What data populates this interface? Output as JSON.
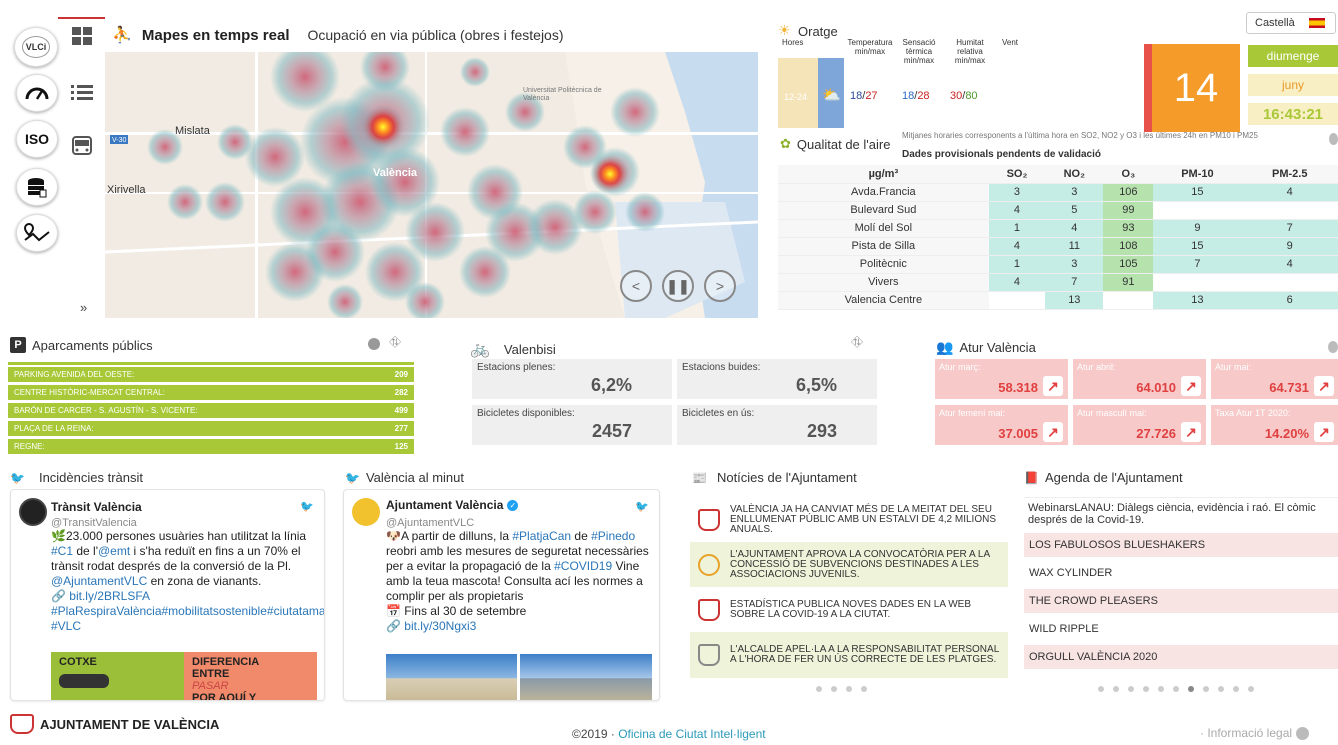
{
  "sidebar": {
    "logo": "VLCi",
    "iso_label": "ISO",
    "expand_label": "»"
  },
  "map": {
    "title": "Mapes en temps real",
    "subtitle": "Ocupació en via pública (obres i festejos)",
    "labels": {
      "mislata": "Mislata",
      "xirivella": "Xirivella",
      "valencia": "València",
      "university": "Universitat Politècnica de València",
      "road": "V-30"
    }
  },
  "weather": {
    "title": "Oratge",
    "col_hours": "Hores",
    "col_temp": "Temperatura min/max",
    "col_feel": "Sensació tèrmica min/max",
    "col_humidity": "Humitat relativa min/max",
    "col_wind": "Vent",
    "hours": "12-24",
    "temp_min": "18",
    "temp_max": "27",
    "feel_min": "18",
    "feel_max": "28",
    "hum_min": "30",
    "hum_max": "80",
    "sep": "/",
    "big_number": "14",
    "language": "Castellà",
    "day": "diumenge",
    "month": "juny",
    "time": "16:43:21"
  },
  "air": {
    "title": "Qualitat de l'aire",
    "note": "Mitjanes horaries corresponents a l'última hora en SO2, NO2 y O3 i les últimes 24h en PM10 i PM25",
    "warning": "Dades provisionals pendents de validació",
    "headers": [
      "µg/m³",
      "SO₂",
      "NO₂",
      "O₃",
      "PM-10",
      "PM-2.5"
    ],
    "rows": [
      [
        "Avda.Francia",
        "3",
        "3",
        "106",
        "15",
        "4"
      ],
      [
        "Bulevard Sud",
        "4",
        "5",
        "99",
        "",
        ""
      ],
      [
        "Molí del Sol",
        "1",
        "4",
        "93",
        "9",
        "7"
      ],
      [
        "Pista de Silla",
        "4",
        "11",
        "108",
        "15",
        "9"
      ],
      [
        "Politècnic",
        "1",
        "3",
        "105",
        "7",
        "4"
      ],
      [
        "Vivers",
        "4",
        "7",
        "91",
        "",
        ""
      ],
      [
        "Valencia Centre",
        "",
        "13",
        "",
        "13",
        "6"
      ]
    ]
  },
  "parking": {
    "title": "Aparcaments públics",
    "rows": [
      {
        "name": "PARKING AVENIDA DEL OESTE:",
        "value": "209"
      },
      {
        "name": "CENTRE HISTÒRIC-MERCAT CENTRAL:",
        "value": "282"
      },
      {
        "name": "BARÓN DE CARCER - S. AGUSTÍN - S. VICENTE:",
        "value": "499"
      },
      {
        "name": "PLAÇA DE LA REINA:",
        "value": "277"
      },
      {
        "name": "REGNE:",
        "value": "125"
      }
    ]
  },
  "valenbisi": {
    "title": "Valenbisi",
    "full_label": "Estacions plenes:",
    "full_value": "6,2%",
    "empty_label": "Estacions buides:",
    "empty_value": "6,5%",
    "avail_label": "Bicicletes disponibles:",
    "avail_value": "2457",
    "use_label": "Bicicletes en ús:",
    "use_value": "293"
  },
  "atur": {
    "title": "Atur València",
    "boxes": [
      {
        "label": "Atur març:",
        "value": "58.318"
      },
      {
        "label": "Atur abril:",
        "value": "64.010"
      },
      {
        "label": "Atur mai:",
        "value": "64.731"
      },
      {
        "label": "Atur femení mai:",
        "value": "37.005"
      },
      {
        "label": "Atur masculí mai:",
        "value": "27.726"
      },
      {
        "label": "Taxa Atur 1T 2020:",
        "value": "14.20%"
      }
    ]
  },
  "traffic": {
    "title": "Incidències trànsit",
    "name": "Trànsit València",
    "handle": "@TransitValencia",
    "text1": "23.000 persones usuàries han utilitzat la línia ",
    "tag1": "#C1",
    "text2": " de l'",
    "mention1": "@emt",
    "text3": " i s'ha reduït en fins a un 70% el trànsit rodat després de la conversió de la Pl. ",
    "mention2": "@AjuntamentVLC",
    "text4": " en zona de vianants.",
    "link": "bit.ly/2BRLSFA",
    "tags": "#PlaRespiraValència#mobilitatsostenible#ciutatamable#València #VLC",
    "img_text1": "COTXE",
    "img_text2": "DIFERENCIA ENTRE",
    "img_text3": "PASAR",
    "img_text4": "POR AQUÍ Y"
  },
  "minute": {
    "title": "València al minut",
    "name": "Ajuntament València",
    "handle": "@AjuntamentVLC",
    "text1": "A partir de dilluns, la ",
    "tag1": "#PlatjaCan",
    "text2": " de ",
    "tag2": "#Pinedo",
    "text3": " reobri amb les mesures de seguretat necessàries per a evitar la propagació de la ",
    "tag3": "#COVID19",
    "text4": " Vine amb la teua mascota! Consulta ací les normes a complir per als propietaris",
    "date_line": "Fins al 30 de setembre",
    "link": "bit.ly/30Ngxi3"
  },
  "news": {
    "title": "Notícies de l'Ajuntament",
    "items": [
      "VALÈNCIA JA HA CANVIAT MÉS DE LA MEITAT DEL SEU ENLLUMENAT PÚBLIC AMB UN ESTALVI DE 4,2 MILIONS ANUALS.",
      "L'AJUNTAMENT APROVA LA CONVOCATÒRIA PER A LA CONCESSIÓ DE SUBVENCIONS DESTINADES A LES ASSOCIACIONS JUVENILS.",
      "ESTADÍSTICA PUBLICA NOVES DADES EN LA WEB SOBRE LA COVID-19 A LA CIUTAT.",
      "L'ALCALDE APEL·LA A LA RESPONSABILITAT PERSONAL A L'HORA DE FER UN ÚS CORRECTE DE LES PLATGES."
    ]
  },
  "agenda": {
    "title": "Agenda de l'Ajuntament",
    "first": "WebinarsLANAU: Diàlegs ciència, evidència i raó. El còmic després de la Covid-19.",
    "items": [
      "LOS FABULOSOS BLUESHAKERS",
      "WAX CYLINDER",
      "THE CROWD PLEASERS",
      "WILD RIPPLE",
      "ORGULL VALÈNCIA 2020"
    ]
  },
  "footer": {
    "org": "AJUNTAMENT DE VALÈNCIA",
    "copy": "©2019 · ",
    "office": "Oficina de Ciutat Intel·ligent",
    "legal": "· Informació legal"
  },
  "colors": {
    "green": "#a8c838",
    "orange": "#f59b2a",
    "teal": "#c6ece6",
    "pink": "#f7c9c9",
    "red_arrow": "#e04040"
  }
}
